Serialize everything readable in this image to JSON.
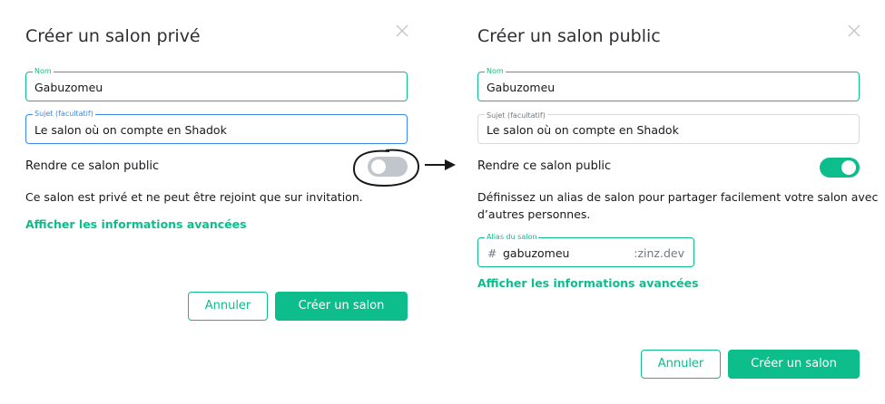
{
  "left": {
    "title": "Créer un salon privé",
    "name_field": {
      "legend": "Nom",
      "value": "Gabuzomeu"
    },
    "topic_field": {
      "legend": "Sujet (facultatif)",
      "value": "Le salon où on compte en Shadok"
    },
    "public_toggle": {
      "label": "Rendre ce salon public",
      "state": "off"
    },
    "description": "Ce salon est privé et ne peut être rejoint que sur invitation.",
    "advanced_link": "Afficher les informations avancées",
    "cancel_label": "Annuler",
    "create_label": "Créer un salon"
  },
  "right": {
    "title": "Créer un salon public",
    "name_field": {
      "legend": "Nom",
      "value": "Gabuzomeu"
    },
    "topic_field": {
      "legend": "Sujet (facultatif)",
      "value": "Le salon où on compte en Shadok"
    },
    "public_toggle": {
      "label": "Rendre ce salon public",
      "state": "on"
    },
    "description_line1": "Définissez un alias de salon pour partager facilement votre salon avec",
    "description_line2": "d’autres personnes.",
    "alias_field": {
      "legend": "Alias du salon",
      "prefix": "#",
      "value": "gabuzomeu",
      "suffix": ":zinz.dev"
    },
    "advanced_link": "Afficher les informations avancées",
    "cancel_label": "Annuler",
    "create_label": "Créer un salon"
  },
  "colors": {
    "accent": "#0dbd8b",
    "focus_blue": "#3a87f0",
    "toggle_off": "#c1c6cd",
    "border": "#d7d9dc"
  },
  "icons": [
    "close-icon",
    "arrow-icon"
  ]
}
